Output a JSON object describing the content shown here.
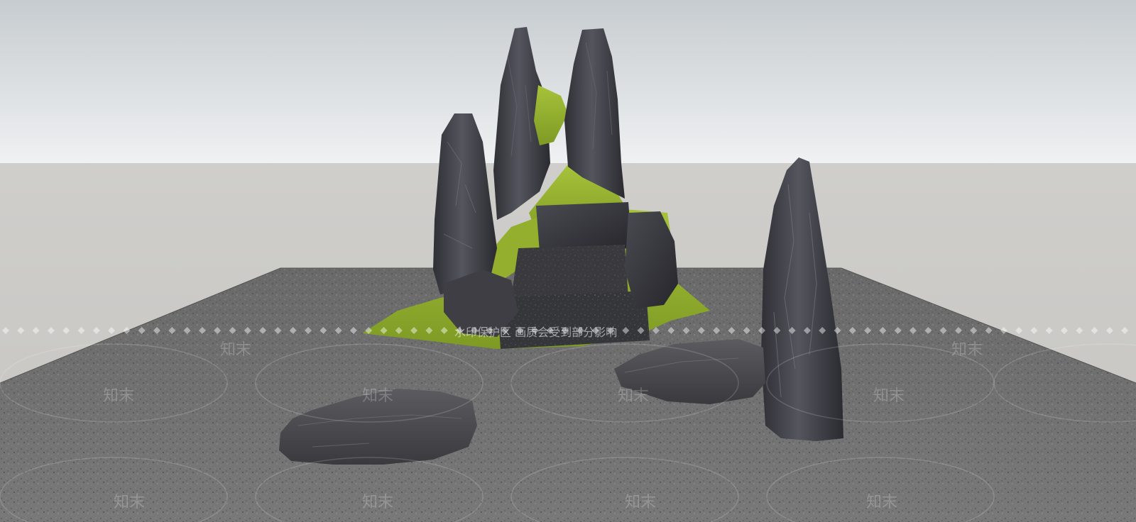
{
  "scene": {
    "watermark_brand": "知末",
    "protection_notice": "水印保护区   画质会受到部分影响",
    "colors": {
      "sky_top": "#c9ced2",
      "sky_bottom": "#eef0f1",
      "ground_plane": "#cfceca",
      "gravel_base": "#6e6e6e",
      "rock_dark": "#3a3a40",
      "rock_light": "#5a5a62",
      "moss": "#8aa62a",
      "moss_light": "#a9c23a"
    },
    "objects": [
      "rockery-group",
      "standing-stone",
      "flat-stone-left",
      "flat-stone-right",
      "gravel-platform"
    ]
  }
}
